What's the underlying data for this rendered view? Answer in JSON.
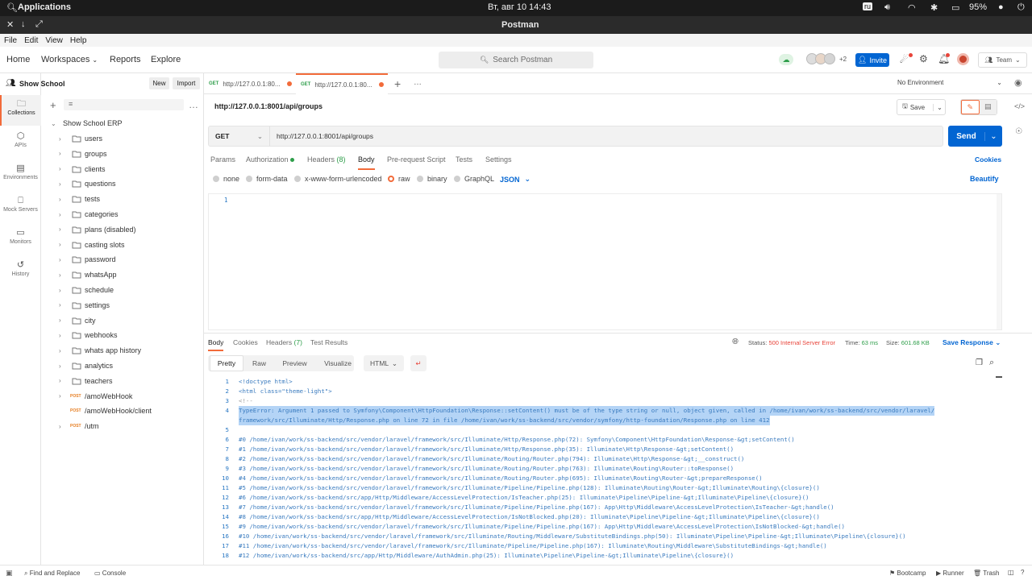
{
  "os_bar": {
    "applications": "Applications",
    "datetime_day": "Вт, авг 10",
    "datetime_time": "14:43",
    "kbd_layout": "ru",
    "battery": "95%"
  },
  "window": {
    "title": "Postman"
  },
  "menu": [
    "File",
    "Edit",
    "View",
    "Help"
  ],
  "header": {
    "nav": {
      "home": "Home",
      "workspaces": "Workspaces",
      "reports": "Reports",
      "explore": "Explore"
    },
    "search_placeholder": "Search Postman",
    "avatars_more": "+2",
    "invite": "Invite",
    "team": "Team"
  },
  "rail": [
    {
      "label": "Collections",
      "icon": "collections-icon"
    },
    {
      "label": "APIs",
      "icon": "apis-icon"
    },
    {
      "label": "Environments",
      "icon": "environments-icon"
    },
    {
      "label": "Mock Servers",
      "icon": "mock-servers-icon"
    },
    {
      "label": "Monitors",
      "icon": "monitors-icon"
    },
    {
      "label": "History",
      "icon": "history-icon"
    }
  ],
  "sidebar": {
    "workspace": "Show School",
    "new": "New",
    "import": "Import",
    "collection": "Show School ERP",
    "folders": [
      "users",
      "groups",
      "clients",
      "questions",
      "tests",
      "categories",
      "plans (disabled)",
      "casting slots",
      "password",
      "whatsApp",
      "schedule",
      "settings",
      "city",
      "webhooks",
      "whats app history",
      "analytics",
      "teachers"
    ],
    "requests": [
      {
        "method": "POST",
        "name": "/amoWebHook"
      },
      {
        "method": "POST",
        "name": "/amoWebHook/client"
      },
      {
        "method": "POST",
        "name": "/utm"
      }
    ]
  },
  "tabs": [
    {
      "method": "GET",
      "title": "http://127.0.0.1:80..."
    },
    {
      "method": "GET",
      "title": "http://127.0.0.1:80..."
    }
  ],
  "environment": "No Environment",
  "request": {
    "name": "http://127.0.0.1:8001/api/groups",
    "save": "Save",
    "method": "GET",
    "url": "http://127.0.0.1:8001/api/groups",
    "send": "Send",
    "subtabs": {
      "params": "Params",
      "authorization": "Authorization",
      "headers": "Headers",
      "headers_count": "(8)",
      "body": "Body",
      "prerequest": "Pre-request Script",
      "tests": "Tests",
      "settings": "Settings",
      "cookies": "Cookies"
    },
    "body_modes": [
      "none",
      "form-data",
      "x-www-form-urlencoded",
      "raw",
      "binary",
      "GraphQL"
    ],
    "body_format": "JSON",
    "beautify": "Beautify",
    "editor_line": "1"
  },
  "response": {
    "tabs": {
      "body": "Body",
      "cookies": "Cookies",
      "headers": "Headers",
      "headers_count": "(7)",
      "test_results": "Test Results"
    },
    "status_label": "Status:",
    "status": "500 Internal Server Error",
    "time_label": "Time:",
    "time": "63 ms",
    "size_label": "Size:",
    "size": "601.68 KB",
    "save_response": "Save Response",
    "views": {
      "pretty": "Pretty",
      "raw": "Raw",
      "preview": "Preview",
      "visualize": "Visualize"
    },
    "format": "HTML",
    "lines": [
      {
        "n": "1",
        "text": "<!doctype html>"
      },
      {
        "n": "2",
        "text": "<html class=\"theme-light\">"
      },
      {
        "n": "3",
        "text": "<!--"
      },
      {
        "n": "4",
        "text": "TypeError: Argument 1 passed to Symfony\\Component\\HttpFoundation\\Response::setContent() must be of the type string or null, object given, called in /home/ivan/work/ss-backend/src/vendor/laravel/"
      },
      {
        "n": "",
        "text": "    framework/src/Illuminate/Http/Response.php on line 72 in file /home/ivan/work/ss-backend/src/vendor/symfony/http-foundation/Response.php on line 412"
      },
      {
        "n": "5",
        "text": ""
      },
      {
        "n": "6",
        "text": "#0 /home/ivan/work/ss-backend/src/vendor/laravel/framework/src/Illuminate/Http/Response.php(72): Symfony\\Component\\HttpFoundation\\Response-&gt;setContent()"
      },
      {
        "n": "7",
        "text": "#1 /home/ivan/work/ss-backend/src/vendor/laravel/framework/src/Illuminate/Http/Response.php(35): Illuminate\\Http\\Response-&gt;setContent()"
      },
      {
        "n": "8",
        "text": "#2 /home/ivan/work/ss-backend/src/vendor/laravel/framework/src/Illuminate/Routing/Router.php(794): Illuminate\\Http\\Response-&gt;__construct()"
      },
      {
        "n": "9",
        "text": "#3 /home/ivan/work/ss-backend/src/vendor/laravel/framework/src/Illuminate/Routing/Router.php(763): Illuminate\\Routing\\Router::toResponse()"
      },
      {
        "n": "10",
        "text": "#4 /home/ivan/work/ss-backend/src/vendor/laravel/framework/src/Illuminate/Routing/Router.php(695): Illuminate\\Routing\\Router-&gt;prepareResponse()"
      },
      {
        "n": "11",
        "text": "#5 /home/ivan/work/ss-backend/src/vendor/laravel/framework/src/Illuminate/Pipeline/Pipeline.php(128): Illuminate\\Routing\\Router-&gt;Illuminate\\Routing\\{closure}()"
      },
      {
        "n": "12",
        "text": "#6 /home/ivan/work/ss-backend/src/app/Http/Middleware/AccessLevelProtection/IsTeacher.php(25): Illuminate\\Pipeline\\Pipeline-&gt;Illuminate\\Pipeline\\{closure}()"
      },
      {
        "n": "13",
        "text": "#7 /home/ivan/work/ss-backend/src/vendor/laravel/framework/src/Illuminate/Pipeline/Pipeline.php(167): App\\Http\\Middleware\\AccessLevelProtection\\IsTeacher-&gt;handle()"
      },
      {
        "n": "14",
        "text": "#8 /home/ivan/work/ss-backend/src/app/Http/Middleware/AccessLevelProtection/IsNotBlocked.php(20): Illuminate\\Pipeline\\Pipeline-&gt;Illuminate\\Pipeline\\{closure}()"
      },
      {
        "n": "15",
        "text": "#9 /home/ivan/work/ss-backend/src/vendor/laravel/framework/src/Illuminate/Pipeline/Pipeline.php(167): App\\Http\\Middleware\\AccessLevelProtection\\IsNotBlocked-&gt;handle()"
      },
      {
        "n": "16",
        "text": "#10 /home/ivan/work/ss-backend/src/vendor/laravel/framework/src/Illuminate/Routing/Middleware/SubstituteBindings.php(50): Illuminate\\Pipeline\\Pipeline-&gt;Illuminate\\Pipeline\\{closure}()"
      },
      {
        "n": "17",
        "text": "#11 /home/ivan/work/ss-backend/src/vendor/laravel/framework/src/Illuminate/Pipeline/Pipeline.php(167): Illuminate\\Routing\\Middleware\\SubstituteBindings-&gt;handle()"
      },
      {
        "n": "18",
        "text": "#12 /home/ivan/work/ss-backend/src/app/Http/Middleware/AuthAdmin.php(25): Illuminate\\Pipeline\\Pipeline-&gt;Illuminate\\Pipeline\\{closure}()"
      }
    ]
  },
  "footer": {
    "find_replace": "Find and Replace",
    "console": "Console",
    "bootcamp": "Bootcamp",
    "runner": "Runner",
    "trash": "Trash"
  },
  "colors": {
    "accent": "#f26b3a",
    "primary": "#0265d2",
    "error": "#e8443a",
    "success": "#2e9e4a"
  }
}
